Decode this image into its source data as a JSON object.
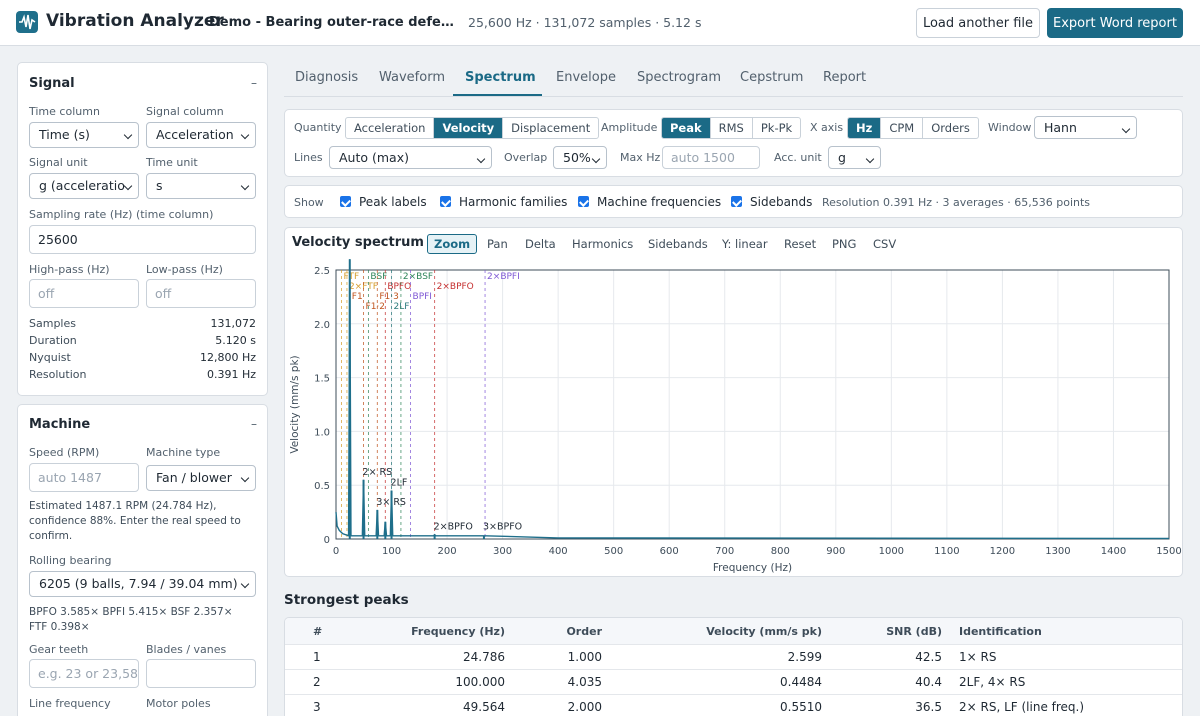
{
  "header": {
    "title": "Vibration Analyzer",
    "file": "Demo - Bearing outer-race defect (sy…",
    "meta": "25,600 Hz · 131,072 samples · 5.12 s",
    "load_btn": "Load another file",
    "export_btn": "Export Word report"
  },
  "signal": {
    "title": "Signal",
    "collapse": "–",
    "time_col_label": "Time column",
    "time_col": "Time (s)",
    "sig_col_label": "Signal column",
    "sig_col": "Acceleration",
    "sig_unit_label": "Signal unit",
    "sig_unit": "g (acceleratio",
    "time_unit_label": "Time unit",
    "time_unit": "s",
    "fs_label": "Sampling rate (Hz) (time column)",
    "fs": "25600",
    "hp_label": "High-pass (Hz)",
    "hp_ph": "off",
    "lp_label": "Low-pass (Hz)",
    "lp_ph": "off",
    "stats": [
      {
        "k": "Samples",
        "v": "131,072"
      },
      {
        "k": "Duration",
        "v": "5.120 s"
      },
      {
        "k": "Nyquist",
        "v": "12,800 Hz"
      },
      {
        "k": "Resolution",
        "v": "0.391 Hz"
      }
    ]
  },
  "machine": {
    "title": "Machine",
    "collapse": "–",
    "speed_label": "Speed (RPM)",
    "speed_ph": "auto 1487",
    "type_label": "Machine type",
    "type": "Fan / blower",
    "estimate": "Estimated 1487.1 RPM (24.784 Hz), confidence 88%. Enter the real speed to confirm.",
    "bearing_label": "Rolling bearing",
    "bearing": "6205 (9 balls, 7.94 / 39.04 mm)",
    "bearing_note": "BPFO 3.585× BPFI 5.415× BSF 2.357× FTF 0.398×",
    "gear_label": "Gear teeth",
    "gear_ph": "e.g. 23 or 23,58",
    "blades_label": "Blades / vanes",
    "line_label": "Line frequency",
    "poles_label": "Motor poles"
  },
  "tabs": [
    "Diagnosis",
    "Waveform",
    "Spectrum",
    "Envelope",
    "Spectrogram",
    "Cepstrum",
    "Report"
  ],
  "controls": {
    "quantity_label": "Quantity",
    "quantity": [
      "Acceleration",
      "Velocity",
      "Displacement"
    ],
    "amplitude_label": "Amplitude",
    "amplitude": [
      "Peak",
      "RMS",
      "Pk-Pk"
    ],
    "xaxis_label": "X axis",
    "xaxis": [
      "Hz",
      "CPM",
      "Orders"
    ],
    "window_label": "Window",
    "window": "Hann",
    "lines_label": "Lines",
    "lines": "Auto (max)",
    "overlap_label": "Overlap",
    "overlap": "50%",
    "maxhz_label": "Max Hz",
    "maxhz_ph": "auto 1500",
    "accunit_label": "Acc. unit",
    "accunit": "g"
  },
  "show": {
    "label": "Show",
    "items": [
      "Peak labels",
      "Harmonic families",
      "Machine frequencies",
      "Sidebands"
    ],
    "resolution": "Resolution 0.391 Hz · 3 averages · 65,536 points"
  },
  "chart_title": "Velocity spectrum",
  "chart_tools": [
    "Zoom",
    "Pan",
    "Delta",
    "Harmonics",
    "Sidebands",
    "Y: linear",
    "Reset",
    "PNG",
    "CSV"
  ],
  "chart_data": {
    "type": "line",
    "title": "",
    "xlabel": "Frequency (Hz)",
    "ylabel": "Velocity (mm/s pk)",
    "xlim": [
      0,
      1500
    ],
    "ylim": [
      0,
      2.5
    ],
    "xticks": [
      0,
      100,
      200,
      300,
      400,
      500,
      600,
      700,
      800,
      900,
      1000,
      1100,
      1200,
      1300,
      1400,
      1500
    ],
    "yticks": [
      0,
      0.5,
      1.0,
      1.5,
      2.0,
      2.5
    ],
    "ytick_labels": [
      "0",
      "0.5",
      "1.0",
      "1.5",
      "2.0",
      "2.5"
    ],
    "grid": true,
    "series": [
      {
        "peaks": [
          {
            "x": 24.8,
            "y": 2.6
          },
          {
            "x": 49.6,
            "y": 0.55
          },
          {
            "x": 74.4,
            "y": 0.27
          },
          {
            "x": 88.8,
            "y": 0.16
          },
          {
            "x": 100,
            "y": 0.45
          },
          {
            "x": 177.6,
            "y": 0.04
          },
          {
            "x": 266.4,
            "y": 0.03
          }
        ]
      }
    ],
    "peak_labels": [
      {
        "x": 49.6,
        "y": 0.55,
        "text": "2× RS"
      },
      {
        "x": 74.4,
        "y": 0.27,
        "text": "3× RS"
      },
      {
        "x": 100,
        "y": 0.45,
        "text": "2LF"
      },
      {
        "x": 177.6,
        "y": 0.04,
        "text": "2×BPFO"
      },
      {
        "x": 266.4,
        "y": 0.04,
        "text": "3×BPFO"
      }
    ],
    "markers": [
      {
        "x": 9.9,
        "text": "FTF",
        "color": "#d69e2e",
        "row": 0
      },
      {
        "x": 19.7,
        "text": "2×FTF",
        "color": "#d69e2e",
        "row": 1
      },
      {
        "x": 24.8,
        "text": "F1",
        "color": "#c05621",
        "row": 2
      },
      {
        "x": 49.6,
        "text": "F1·2",
        "color": "#c05621",
        "row": 3
      },
      {
        "x": 58.4,
        "text": "BSF",
        "color": "#2f855a",
        "row": 0
      },
      {
        "x": 74.4,
        "text": "F1·3",
        "color": "#c05621",
        "row": 2
      },
      {
        "x": 88.8,
        "text": "BPFO",
        "color": "#c53030",
        "row": 1
      },
      {
        "x": 100,
        "text": "2LF",
        "color": "#2c7a7b",
        "row": 3
      },
      {
        "x": 116.9,
        "text": "2×BSF",
        "color": "#2f855a",
        "row": 0
      },
      {
        "x": 134.2,
        "text": "BPFI",
        "color": "#805ad5",
        "row": 2
      },
      {
        "x": 177.6,
        "text": "2×BPFO",
        "color": "#c53030",
        "row": 1
      },
      {
        "x": 268.4,
        "text": "2×BPFI",
        "color": "#805ad5",
        "row": 0
      }
    ]
  },
  "peaks_title": "Strongest peaks",
  "peaks_table": {
    "headers": [
      "#",
      "Frequency (Hz)",
      "Order",
      "Velocity (mm/s pk)",
      "SNR (dB)",
      "Identification"
    ],
    "rows": [
      [
        "1",
        "24.786",
        "1.000",
        "2.599",
        "42.5",
        "1× RS"
      ],
      [
        "2",
        "100.000",
        "4.035",
        "0.4484",
        "40.4",
        "2LF, 4× RS"
      ],
      [
        "3",
        "49.564",
        "2.000",
        "0.5510",
        "36.5",
        "2× RS, LF (line freq.)"
      ]
    ]
  },
  "colors": {
    "accent": "#1b6a86",
    "trace": "#1f6f8b",
    "checkbox": "#1a73e8"
  }
}
